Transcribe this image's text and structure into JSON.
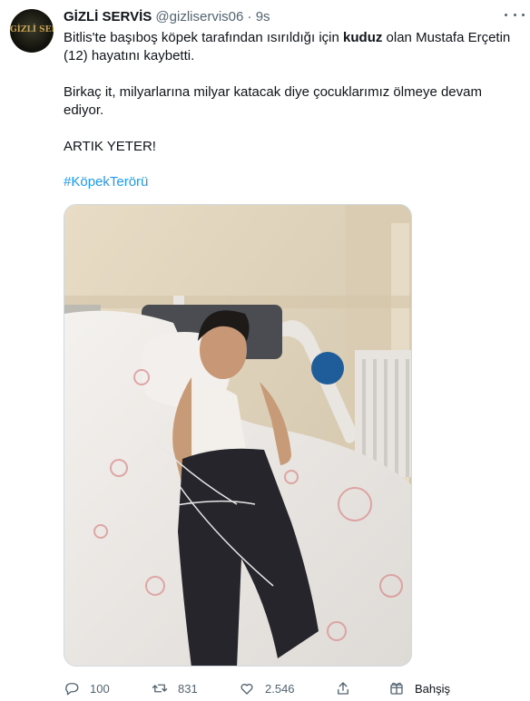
{
  "tweet": {
    "author_name": "GİZLİ SERVİS",
    "author_handle": "@gizliservis06",
    "separator": "·",
    "time": "9s",
    "avatar_text": "GİZLİ SERVİS",
    "line1_a": "Bitlis'te başıboş köpek tarafından ısırıldığı için ",
    "line1_bold": "kuduz",
    "line1_b": " olan Mustafa Erçetin",
    "line2": "(12) hayatını kaybetti.",
    "para2_line1": "Birkaç it, milyarlarına milyar katacak diye çocuklarımız ölmeye devam",
    "para2_line2": "ediyor.",
    "para3": "ARTIK YETER!",
    "hashtag": "#KöpekTerörü"
  },
  "actions": {
    "replies": "100",
    "retweets": "831",
    "likes": "2.546",
    "tip_label": "Bahşiş"
  },
  "colors": {
    "link": "#1d9bf0",
    "secondary_text": "#536471",
    "primary_text": "#0f1419"
  },
  "icons": [
    "more-icon",
    "reply-icon",
    "retweet-icon",
    "like-icon",
    "share-icon",
    "tip-icon"
  ]
}
